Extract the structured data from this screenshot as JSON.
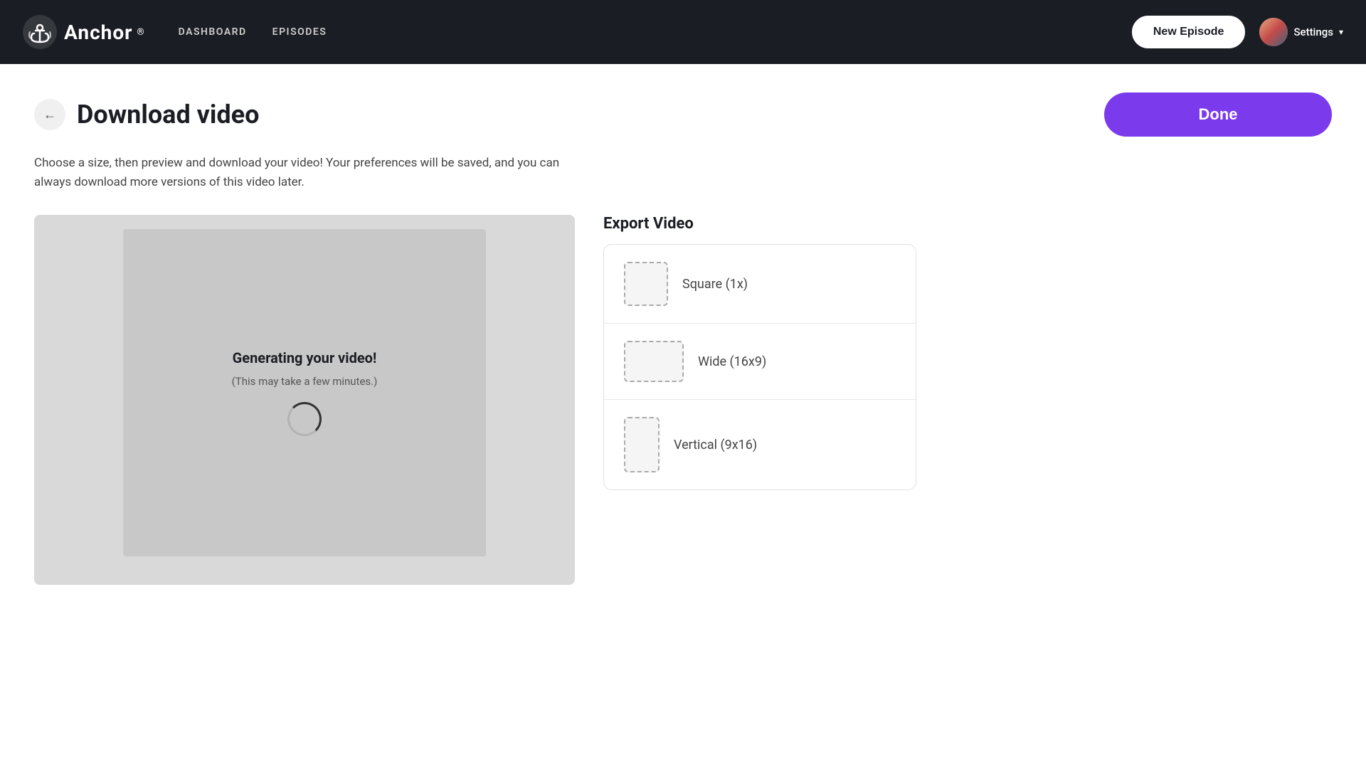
{
  "navbar": {
    "logo_text": "Anchor",
    "logo_reg": "®",
    "nav_links": [
      {
        "label": "DASHBOARD",
        "id": "dashboard"
      },
      {
        "label": "EPISODES",
        "id": "episodes"
      }
    ],
    "new_episode_label": "New Episode",
    "settings_label": "Settings"
  },
  "page": {
    "title": "Download video",
    "done_label": "Done",
    "subtitle": "Choose a size, then preview and download your video! Your preferences will be saved, and you can always download more versions of this video later."
  },
  "video_preview": {
    "generating_title": "Generating your video!",
    "generating_sub": "(This may take a few minutes.)"
  },
  "export": {
    "title": "Export Video",
    "options": [
      {
        "label": "Square (1x)",
        "format": "square"
      },
      {
        "label": "Wide (16x9)",
        "format": "wide"
      },
      {
        "label": "Vertical (9x16)",
        "format": "vertical"
      }
    ]
  }
}
